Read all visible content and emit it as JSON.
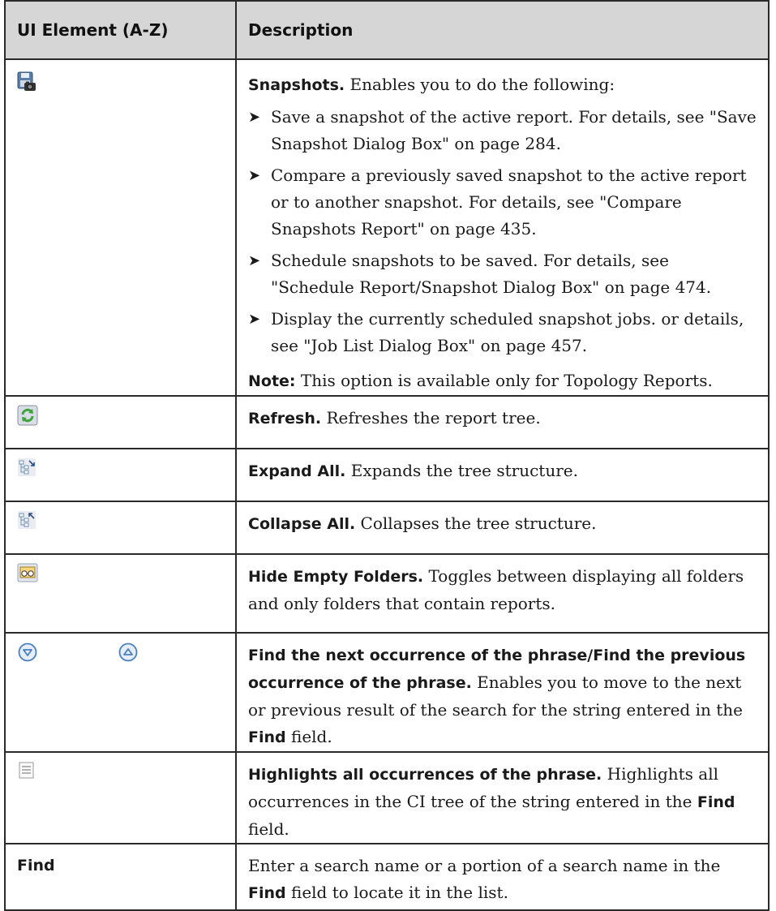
{
  "header": {
    "col_element": "UI Element (A-Z)",
    "col_description": "Description"
  },
  "rows": {
    "snapshots": {
      "icon": "save-snapshot-icon",
      "title": "Snapshots.",
      "intro": " Enables you to do the following:",
      "bullets": [
        "Save a snapshot of the active report. For details, see \"Save Snapshot Dialog Box\" on page 284.",
        "Compare a previously saved snapshot to the active report or to another snapshot. For details, see \"Compare Snapshots Report\" on page 435.",
        "Schedule snapshots to be saved. For details, see \"Schedule Report/Snapshot Dialog Box\" on page 474.",
        "Display the currently scheduled snapshot jobs. or details, see \"Job List Dialog Box\" on page 457."
      ],
      "note_label": "Note:",
      "note_text": " This option is available only for Topology Reports."
    },
    "refresh": {
      "icon": "refresh-icon",
      "title": "Refresh.",
      "text": " Refreshes the report tree."
    },
    "expand_all": {
      "icon": "expand-all-icon",
      "title": "Expand All.",
      "text": " Expands the tree structure."
    },
    "collapse_all": {
      "icon": "collapse-all-icon",
      "title": "Collapse All.",
      "text": " Collapses the tree structure."
    },
    "hide_empty": {
      "icon": "hide-empty-folders-icon",
      "title": "Hide Empty Folders.",
      "text": " Toggles between displaying all folders and only folders that contain reports."
    },
    "find_next_prev": {
      "icons": [
        "find-next-icon",
        "find-previous-icon"
      ],
      "title": "Find the next occurrence of the phrase/Find the previous occurrence of the phrase.",
      "text_a": " Enables you to move to the next or previous result of the search for the string entered in the ",
      "find_word": "Find",
      "text_b": " field."
    },
    "highlight_all": {
      "icon": "highlight-all-icon",
      "title": "Highlights all occurrences of the phrase.",
      "text_a": " Highlights all occurrences in the CI tree of the string entered in the ",
      "find_word": "Find",
      "text_b": " field."
    },
    "find": {
      "element": "Find",
      "text_a": "Enter a search name or a portion of a search name in the ",
      "find_word": "Find",
      "text_b": " field to locate it in the list."
    }
  },
  "bullet_glyph": "➤",
  "colors": {
    "header_bg": "#d6d6d6",
    "border": "#2a2a2a",
    "refresh_green": "#3fa33a",
    "arrow_blue": "#4a7fc0"
  }
}
